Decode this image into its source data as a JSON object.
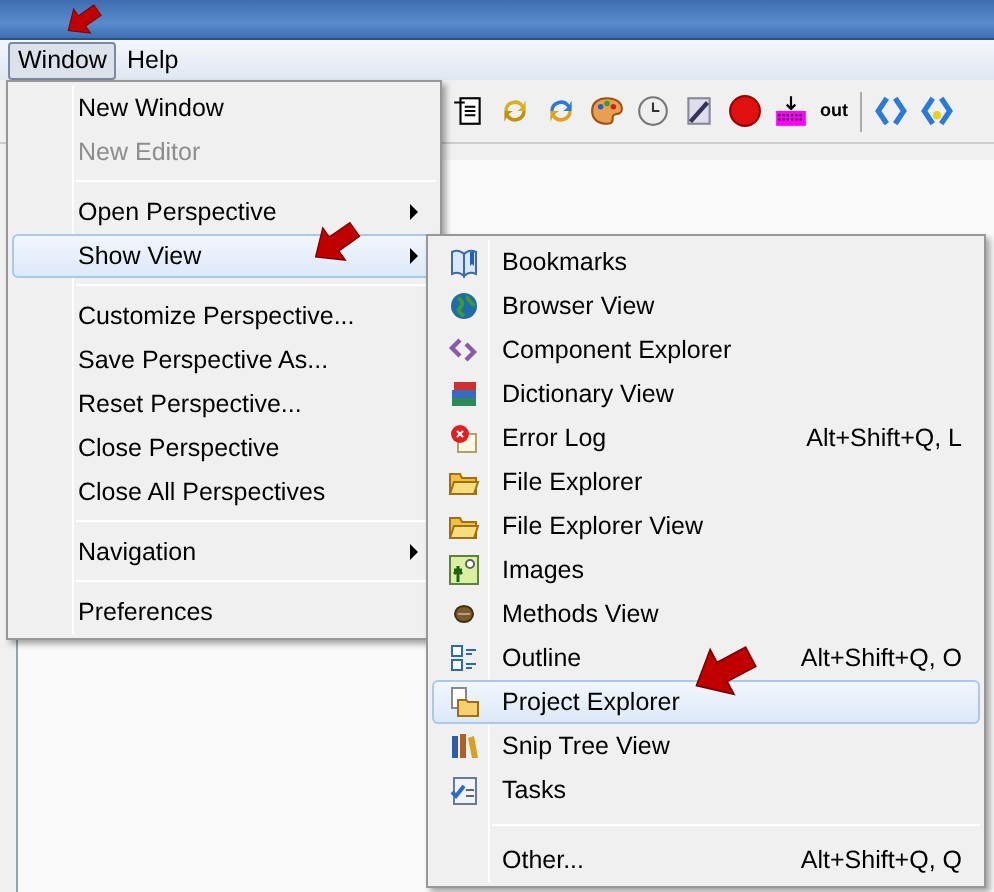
{
  "menu_bar": [
    {
      "label": "Window",
      "selected": true
    },
    {
      "label": "Help",
      "selected": false
    }
  ],
  "toolbar": {
    "text_button": "out"
  },
  "window_menu": [
    {
      "kind": "item",
      "label": "New Window",
      "disabled": false,
      "selected": false
    },
    {
      "kind": "item",
      "label": "New Editor",
      "disabled": true,
      "selected": false
    },
    {
      "kind": "separator"
    },
    {
      "kind": "submenu",
      "label": "Open Perspective",
      "disabled": false,
      "selected": false
    },
    {
      "kind": "submenu",
      "label": "Show View",
      "disabled": false,
      "selected": true
    },
    {
      "kind": "separator"
    },
    {
      "kind": "item",
      "label": "Customize Perspective...",
      "disabled": false,
      "selected": false
    },
    {
      "kind": "item",
      "label": "Save Perspective As...",
      "disabled": false,
      "selected": false
    },
    {
      "kind": "item",
      "label": "Reset Perspective...",
      "disabled": false,
      "selected": false
    },
    {
      "kind": "item",
      "label": "Close Perspective",
      "disabled": false,
      "selected": false
    },
    {
      "kind": "item",
      "label": "Close All Perspectives",
      "disabled": false,
      "selected": false
    },
    {
      "kind": "separator"
    },
    {
      "kind": "submenu",
      "label": "Navigation",
      "disabled": false,
      "selected": false
    },
    {
      "kind": "separator"
    },
    {
      "kind": "item",
      "label": "Preferences",
      "disabled": false,
      "selected": false
    }
  ],
  "show_view_menu": [
    {
      "kind": "item",
      "label": "Bookmarks",
      "selected": false
    },
    {
      "kind": "item",
      "label": "Browser View",
      "selected": false
    },
    {
      "kind": "item",
      "label": "Component Explorer",
      "selected": false
    },
    {
      "kind": "item",
      "label": "Dictionary View",
      "selected": false
    },
    {
      "kind": "item",
      "label": "Error Log",
      "shortcut": "Alt+Shift+Q, L",
      "selected": false
    },
    {
      "kind": "item",
      "label": "File Explorer",
      "selected": false
    },
    {
      "kind": "item",
      "label": "File Explorer View",
      "selected": false
    },
    {
      "kind": "item",
      "label": "Images",
      "selected": false
    },
    {
      "kind": "item",
      "label": "Methods View",
      "selected": false
    },
    {
      "kind": "item",
      "label": "Outline",
      "shortcut": "Alt+Shift+Q, O",
      "selected": false
    },
    {
      "kind": "item",
      "label": "Project Explorer",
      "selected": true
    },
    {
      "kind": "item",
      "label": "Snip Tree View",
      "selected": false
    },
    {
      "kind": "item",
      "label": "Tasks",
      "selected": false
    },
    {
      "kind": "separator"
    },
    {
      "kind": "item",
      "label": "Other...",
      "shortcut": "Alt+Shift+Q, Q",
      "selected": false
    }
  ]
}
